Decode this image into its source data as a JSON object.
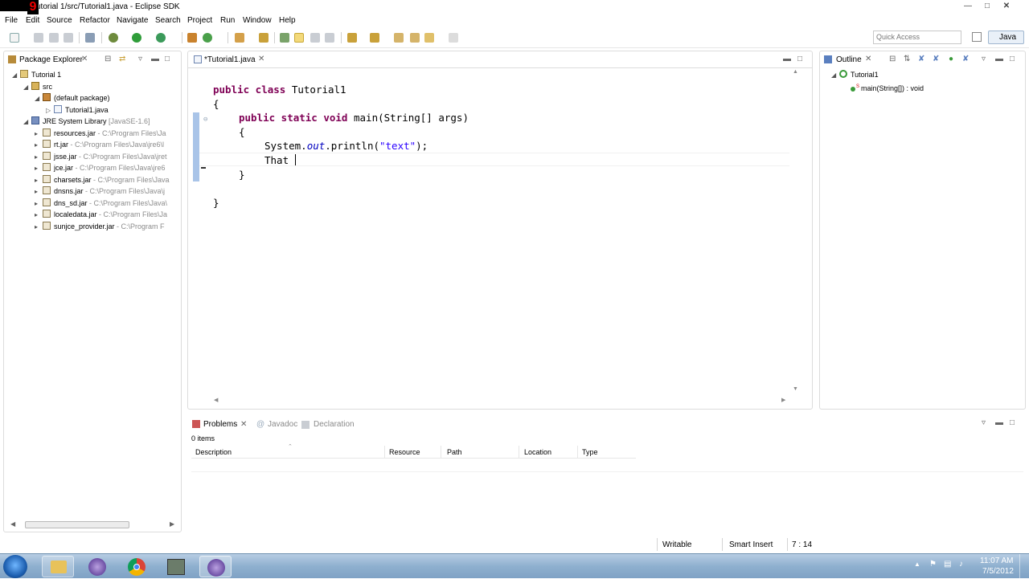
{
  "window": {
    "title": "utorial 1/src/Tutorial1.java - Eclipse SDK"
  },
  "menu": [
    "File",
    "Edit",
    "Source",
    "Refactor",
    "Navigate",
    "Search",
    "Project",
    "Run",
    "Window",
    "Help"
  ],
  "toolbar": {
    "quick_access_placeholder": "Quick Access",
    "perspective": "Java"
  },
  "package_explorer": {
    "tab": "Package Explorer",
    "items": [
      {
        "label": "Tutorial 1",
        "path": "",
        "icon": "project-icon"
      },
      {
        "label": "src",
        "path": "",
        "icon": "source-folder-icon"
      },
      {
        "label": "(default package)",
        "path": "",
        "icon": "package-icon"
      },
      {
        "label": "Tutorial1.java",
        "path": "",
        "icon": "java-file-icon"
      },
      {
        "label": "JRE System Library",
        "path": "[JavaSE-1.6]",
        "icon": "library-icon"
      },
      {
        "label": "resources.jar",
        "path": " - C:\\Program Files\\Ja",
        "icon": "jar-icon"
      },
      {
        "label": "rt.jar",
        "path": " - C:\\Program Files\\Java\\jre6\\l",
        "icon": "jar-icon"
      },
      {
        "label": "jsse.jar",
        "path": " - C:\\Program Files\\Java\\jret",
        "icon": "jar-icon"
      },
      {
        "label": "jce.jar",
        "path": " - C:\\Program Files\\Java\\jre6",
        "icon": "jar-icon"
      },
      {
        "label": "charsets.jar",
        "path": " - C:\\Program Files\\Java",
        "icon": "jar-icon"
      },
      {
        "label": "dnsns.jar",
        "path": " - C:\\Program Files\\Java\\j",
        "icon": "jar-icon"
      },
      {
        "label": "dns_sd.jar",
        "path": " - C:\\Program Files\\Java\\",
        "icon": "jar-icon"
      },
      {
        "label": "localedata.jar",
        "path": " - C:\\Program Files\\Ja",
        "icon": "jar-icon"
      },
      {
        "label": "sunjce_provider.jar",
        "path": " - C:\\Program F",
        "icon": "jar-icon"
      }
    ]
  },
  "editor": {
    "tab": "*Tutorial1.java",
    "code": {
      "l1_kw": "public class",
      "l1_rest": " Tutorial1",
      "l2": "{",
      "l3_kw": "public static void",
      "l3_rest": " main(String[] args)",
      "l4": "{",
      "l5_a": "System.",
      "l5_b": "out",
      "l5_c": ".println(",
      "l5_str": "\"text\"",
      "l5_d": ");",
      "l6": "That ",
      "l7": "}",
      "l8": "}"
    }
  },
  "outline": {
    "tab": "Outline",
    "class": "Tutorial1",
    "method": "main(String[]) : void",
    "static_marker": "S"
  },
  "bottom": {
    "tabs": [
      "Problems",
      "Javadoc",
      "Declaration"
    ],
    "count": "0 items",
    "columns": [
      "Description",
      "Resource",
      "Path",
      "Location",
      "Type"
    ]
  },
  "status": {
    "writable": "Writable",
    "insert": "Smart Insert",
    "position": "7 : 14"
  },
  "taskbar": {
    "time": "11:07 AM",
    "date": "7/5/2012"
  },
  "colors": {
    "keyword": "#7f0055",
    "string": "#2a00ff",
    "path": "#8b8b8b",
    "taskbar": "#8fb0cf"
  }
}
